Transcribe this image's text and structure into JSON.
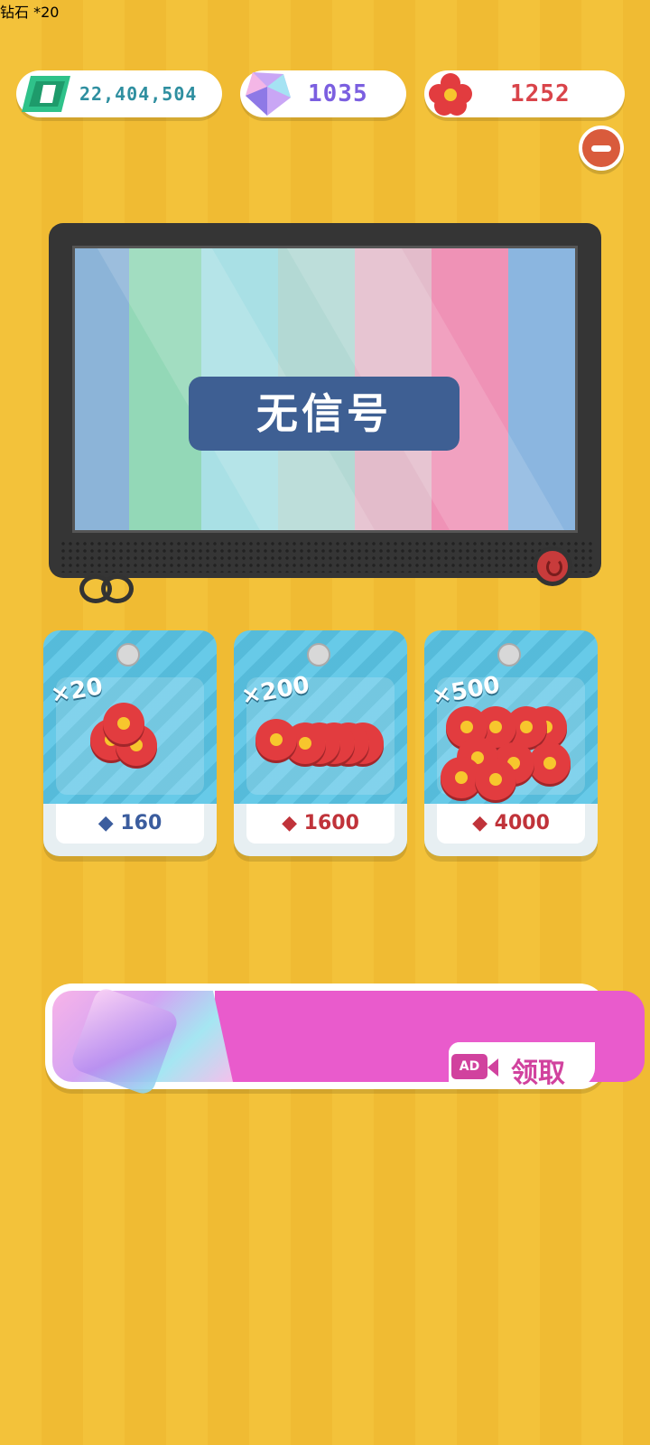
{
  "currencies": {
    "cash": "22,404,504",
    "gems": "1035",
    "flowers": "1252"
  },
  "tv": {
    "message": "无信号",
    "bar_colors": [
      "#8cb4d8",
      "#93d8b7",
      "#a9e0e5",
      "#b3d9d4",
      "#e3bccb",
      "#ef92b6",
      "#8bb6e0"
    ]
  },
  "shop": {
    "packs": [
      {
        "qty": "×20",
        "price": "160",
        "price_color": "#3b5d9e"
      },
      {
        "qty": "×200",
        "price": "1600",
        "price_color": "#c0333a"
      },
      {
        "qty": "×500",
        "price": "4000",
        "price_color": "#c0333a"
      }
    ]
  },
  "reward": {
    "title": "钻石 *20",
    "ad_badge": "AD",
    "claim": "领取"
  },
  "colors": {
    "background": "#f3c23a",
    "cash": "#2f8fa0",
    "gems": "#7b5fe0",
    "flowers": "#d9444a",
    "banner": "#e95bcc"
  }
}
